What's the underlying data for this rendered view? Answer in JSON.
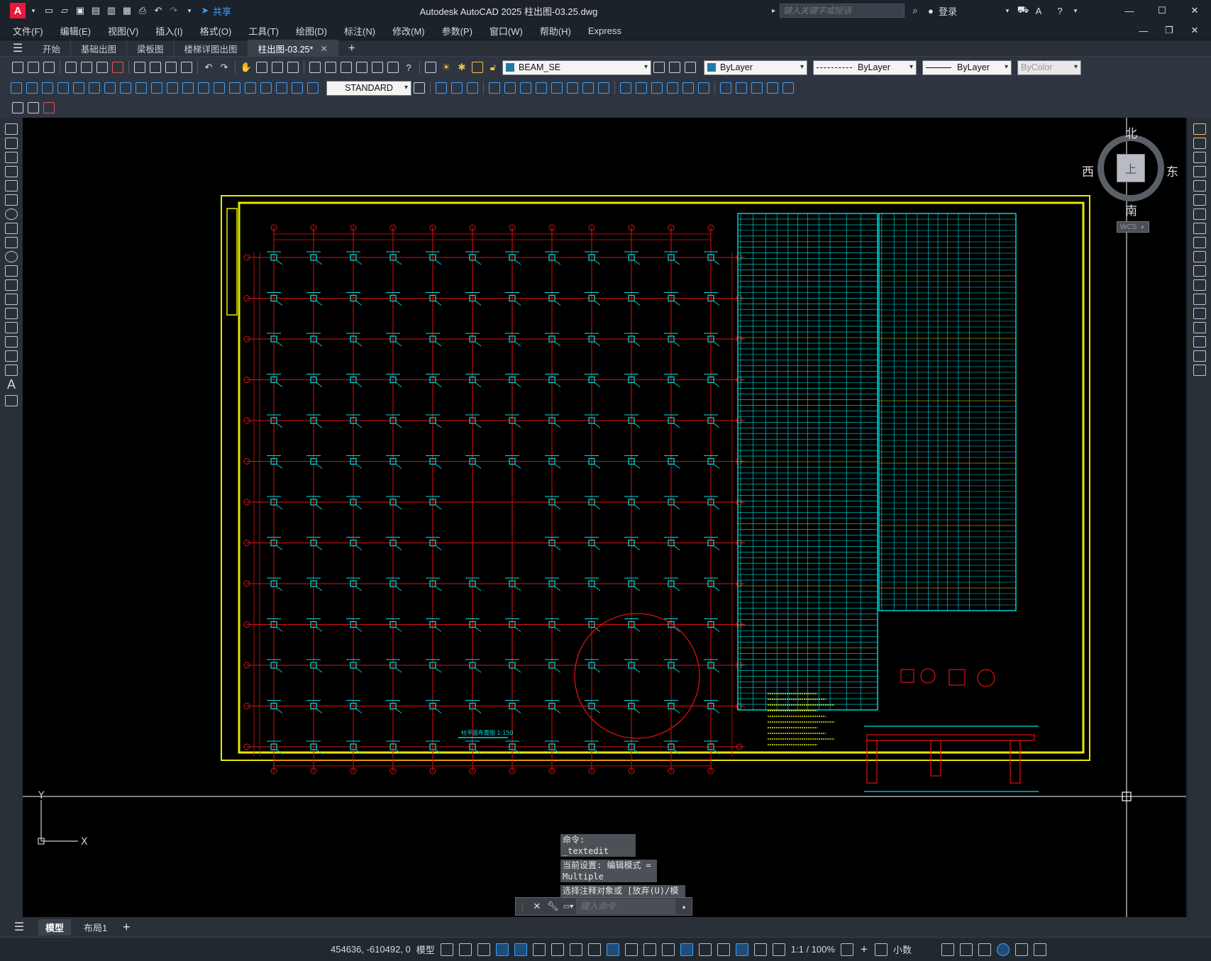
{
  "window": {
    "title": "Autodesk AutoCAD 2025    柱出图-03.25.dwg",
    "share_label": "共享",
    "search_placeholder": "键入关键字或短语",
    "login_label": "登录"
  },
  "menu": [
    "文件(F)",
    "编辑(E)",
    "视图(V)",
    "插入(I)",
    "格式(O)",
    "工具(T)",
    "绘图(D)",
    "标注(N)",
    "修改(M)",
    "参数(P)",
    "窗口(W)",
    "帮助(H)",
    "Express"
  ],
  "tabs": [
    {
      "label": "开始",
      "active": false
    },
    {
      "label": "基础出图",
      "active": false
    },
    {
      "label": "梁板图",
      "active": false
    },
    {
      "label": "楼梯详图出图",
      "active": false
    },
    {
      "label": "柱出图-03.25*",
      "active": true
    }
  ],
  "properties": {
    "layer": "BEAM_SE",
    "color": "ByLayer",
    "linetype": "ByLayer",
    "lineweight": "ByLayer",
    "plotstyle": "ByColor",
    "textstyle": "STANDARD"
  },
  "viewcube": {
    "north": "北",
    "south": "南",
    "east": "东",
    "west": "西",
    "top": "上",
    "wcs": "WCS"
  },
  "drawing": {
    "plan_title": "柱平面布置图 1:150"
  },
  "command": {
    "history": [
      "命令: _textedit",
      "当前设置: 编辑模式 = Multiple",
      "选择注释对象或 [放弃(U)/模式(M)]: *取消*"
    ],
    "placeholder": "键入命令"
  },
  "ucs": {
    "x": "X",
    "y": "Y"
  },
  "layouts": [
    {
      "label": "模型",
      "active": true
    },
    {
      "label": "布局1",
      "active": false
    }
  ],
  "status": {
    "coords": "454636, -610492, 0",
    "space": "模型",
    "scale": "1:1 / 100%",
    "units": "小数"
  },
  "colors": {
    "grid": "#e01010",
    "columns": "#00e0e0",
    "frame": "#e8e800",
    "accent": "#3aa1ff",
    "brand": "#e8193c"
  }
}
